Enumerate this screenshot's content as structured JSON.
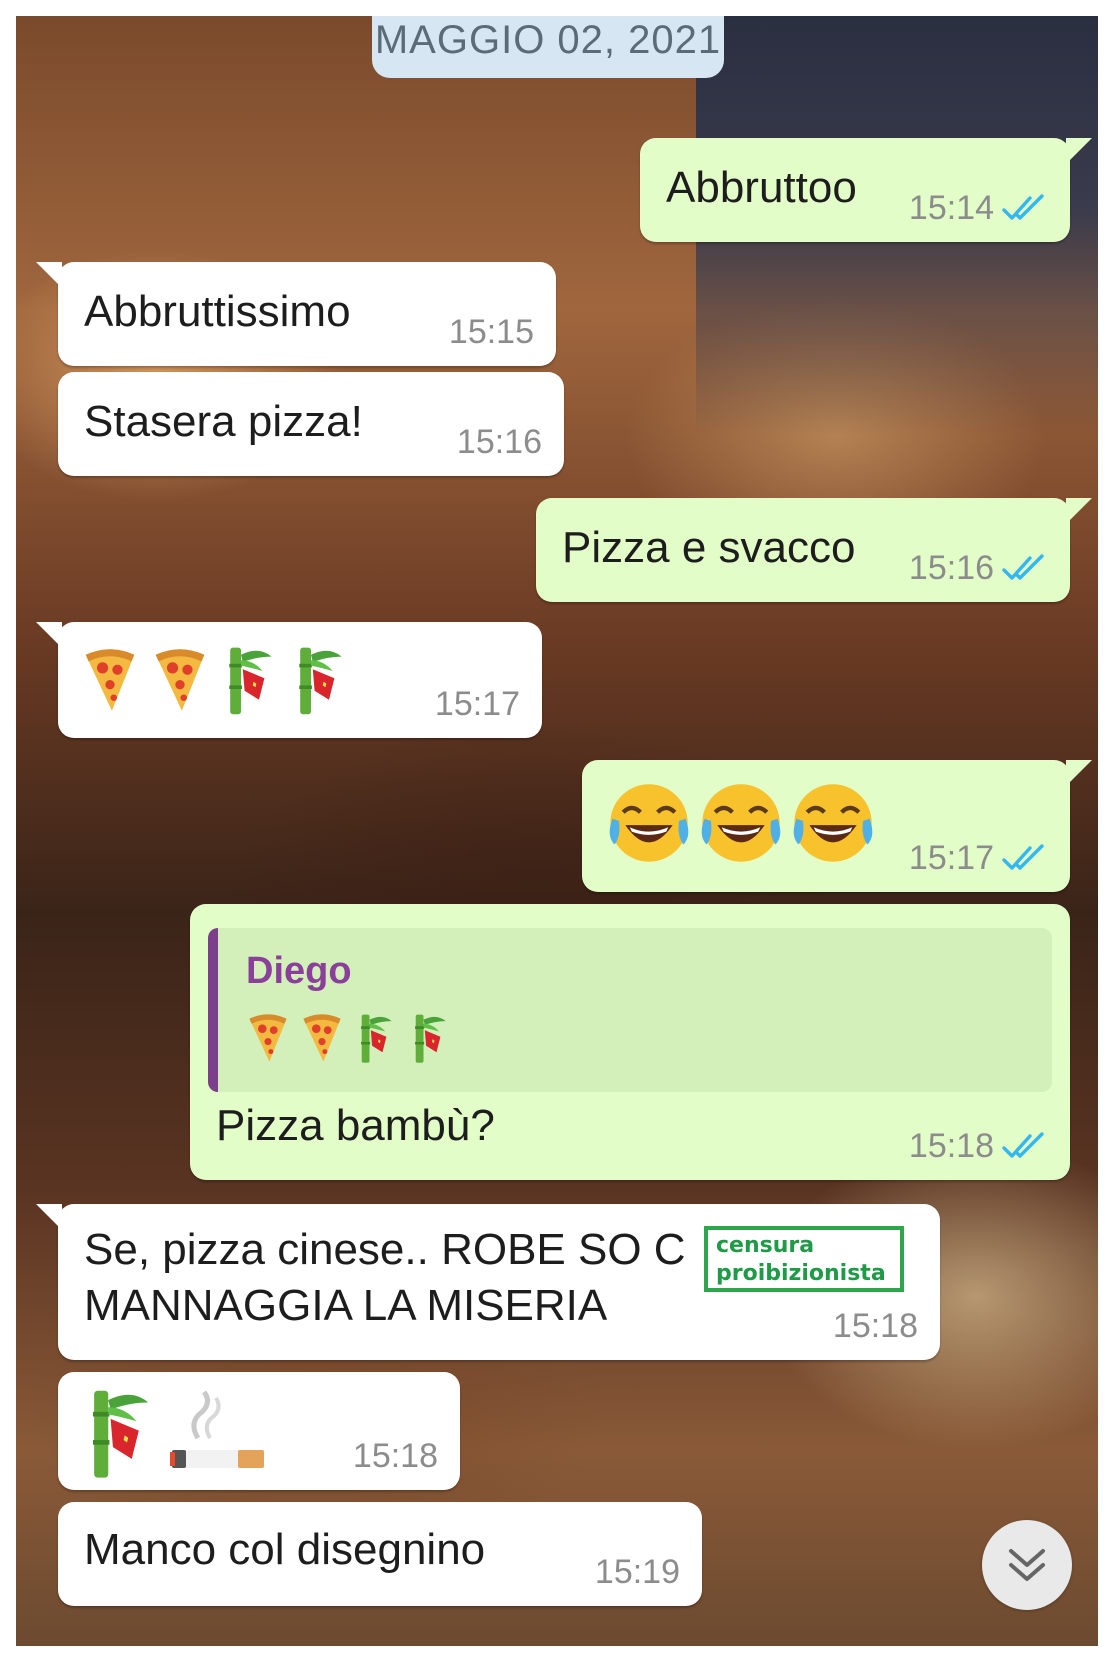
{
  "date_chip": "MAGGIO 02, 2021",
  "messages": [
    {
      "text": "Abbruttoo",
      "time": "15:14"
    },
    {
      "text": "Abbruttissimo",
      "time": "15:15"
    },
    {
      "text": "Stasera pizza!",
      "time": "15:16"
    },
    {
      "text": "Pizza e svacco",
      "time": "15:16"
    },
    {
      "emoji": [
        "pizza-icon",
        "pizza-icon",
        "bamboo-icon",
        "bamboo-icon"
      ],
      "time": "15:17"
    },
    {
      "emoji": [
        "laughing-face-icon",
        "laughing-face-icon",
        "laughing-face-icon"
      ],
      "time": "15:17"
    },
    {
      "quote_name": "Diego",
      "quote_emoji": [
        "pizza-icon",
        "pizza-icon",
        "bamboo-icon",
        "bamboo-icon"
      ],
      "text": "Pizza bambù?",
      "time": "15:18"
    },
    {
      "line1": "Se, pizza cinese.. ROBE SO C",
      "line2": "MANNAGGIA LA MISERIA",
      "time": "15:18"
    },
    {
      "emoji": [
        "bamboo-icon",
        "cigarette-icon"
      ],
      "time": "15:18"
    },
    {
      "text": "Manco col disegnino",
      "time": "15:19"
    }
  ],
  "censor_label": {
    "line1": "censura",
    "line2": "proibizionista"
  },
  "colors": {
    "outgoing_bubble": "#e2fdc8",
    "incoming_bubble": "#ffffff",
    "read_ticks": "#34b7f1",
    "quote_name": "#8a3f9b",
    "censor_border": "#2ca84b"
  }
}
